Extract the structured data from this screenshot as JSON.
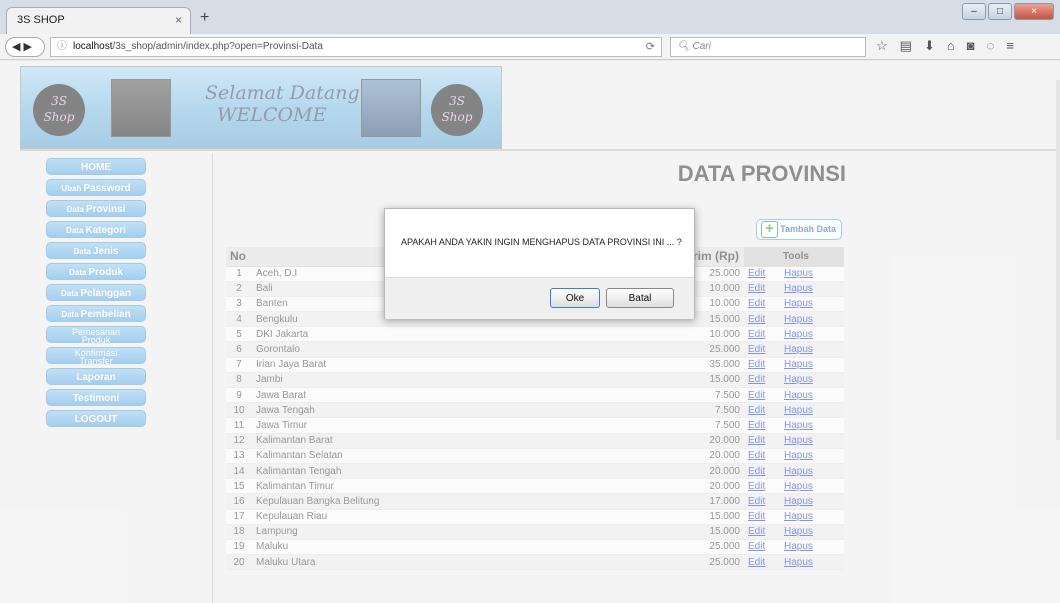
{
  "browser": {
    "tab_title": "3S SHOP",
    "tab_close": "×",
    "new_tab": "+",
    "url_prefix": "localhost",
    "url_rest": "/3s_shop/admin/index.php?open=Provinsi-Data",
    "search_placeholder": "Cari",
    "win_minimize": "–",
    "win_maximize": "□",
    "win_close": "×"
  },
  "banner": {
    "logo_line1": "3S",
    "logo_line2": "Shop",
    "welcome_line1": "Selamat Datang",
    "welcome_line2": "WELCOME"
  },
  "sidebar": {
    "items": [
      {
        "label": "HOME"
      },
      {
        "prefix": "Ubah",
        "label": "Password"
      },
      {
        "prefix": "Data",
        "label": "Provinsi"
      },
      {
        "prefix": "Data",
        "label": "Kategori"
      },
      {
        "prefix": "Data",
        "label": "Jenis"
      },
      {
        "prefix": "Data",
        "label": "Produk"
      },
      {
        "prefix": "Data",
        "label": "Pelanggan"
      },
      {
        "prefix": "Data",
        "label": "Pembelian"
      },
      {
        "line1": "Pemesanan",
        "line2": "Produk"
      },
      {
        "line1": "Konfirmasi",
        "line2": "Transfer"
      },
      {
        "label": "Laporan"
      },
      {
        "label": "Testimoni"
      },
      {
        "label": "LOGOUT"
      }
    ]
  },
  "main": {
    "title": "DATA PROVINSI",
    "add_button": "Tambah Data",
    "table": {
      "headers": {
        "no": "No",
        "ongkir": "Kirim (Rp)",
        "tools": "Tools"
      },
      "edit_label": "Edit",
      "delete_label": "Hapus",
      "rows": [
        {
          "no": "1",
          "provinsi": "Aceh, D.I",
          "ongkir": "25.000"
        },
        {
          "no": "2",
          "provinsi": "Bali",
          "ongkir": "10.000"
        },
        {
          "no": "3",
          "provinsi": "Banten",
          "ongkir": "10.000"
        },
        {
          "no": "4",
          "provinsi": "Bengkulu",
          "ongkir": "15.000"
        },
        {
          "no": "5",
          "provinsi": "DKI Jakarta",
          "ongkir": "10.000"
        },
        {
          "no": "6",
          "provinsi": "Gorontalo",
          "ongkir": "25.000"
        },
        {
          "no": "7",
          "provinsi": "Irian Jaya Barat",
          "ongkir": "35.000"
        },
        {
          "no": "8",
          "provinsi": "Jambi",
          "ongkir": "15.000"
        },
        {
          "no": "9",
          "provinsi": "Jawa Barat",
          "ongkir": "7.500"
        },
        {
          "no": "10",
          "provinsi": "Jawa Tengah",
          "ongkir": "7.500"
        },
        {
          "no": "11",
          "provinsi": "Jawa Timur",
          "ongkir": "7.500"
        },
        {
          "no": "12",
          "provinsi": "Kalimantan Barat",
          "ongkir": "20.000"
        },
        {
          "no": "13",
          "provinsi": "Kalimantan Selatan",
          "ongkir": "20.000"
        },
        {
          "no": "14",
          "provinsi": "Kalimantan Tengah",
          "ongkir": "20.000"
        },
        {
          "no": "15",
          "provinsi": "Kalimantan Timur",
          "ongkir": "20.000"
        },
        {
          "no": "16",
          "provinsi": "Kepulauan Bangka Belitung",
          "ongkir": "17.000"
        },
        {
          "no": "17",
          "provinsi": "Kepulauan Riau",
          "ongkir": "15.000"
        },
        {
          "no": "18",
          "provinsi": "Lampung",
          "ongkir": "15.000"
        },
        {
          "no": "19",
          "provinsi": "Maluku",
          "ongkir": "25.000"
        },
        {
          "no": "20",
          "provinsi": "Maluku Utara",
          "ongkir": "25.000"
        }
      ]
    }
  },
  "dialog": {
    "message": "APAKAH ANDA YAKIN INGIN MENGHAPUS DATA PROVINSI INI ... ?",
    "ok_label": "Oke",
    "cancel_label": "Batal"
  }
}
